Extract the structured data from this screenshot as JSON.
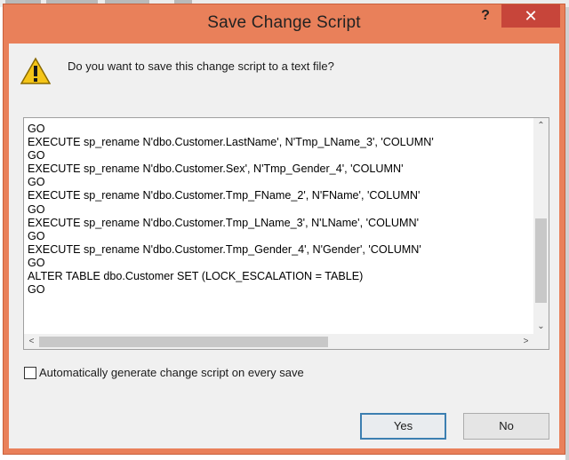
{
  "dialog": {
    "title": "Save Change Script",
    "help_label": "?",
    "close_label": "✕",
    "icon": "warning-icon",
    "prompt": "Do you want to save this change script to a text file?",
    "script_text": "GO\nEXECUTE sp_rename N'dbo.Customer.LastName', N'Tmp_LName_3', 'COLUMN'\nGO\nEXECUTE sp_rename N'dbo.Customer.Sex', N'Tmp_Gender_4', 'COLUMN'\nGO\nEXECUTE sp_rename N'dbo.Customer.Tmp_FName_2', N'FName', 'COLUMN'\nGO\nEXECUTE sp_rename N'dbo.Customer.Tmp_LName_3', N'LName', 'COLUMN'\nGO\nEXECUTE sp_rename N'dbo.Customer.Tmp_Gender_4', N'Gender', 'COLUMN'\nGO\nALTER TABLE dbo.Customer SET (LOCK_ESCALATION = TABLE)\nGO",
    "auto_generate_label": "Automatically generate change script on every save",
    "auto_generate_checked": false,
    "yes_label": "Yes",
    "no_label": "No",
    "scroll_up": "⌃",
    "scroll_down": "⌄",
    "scroll_left": "<",
    "scroll_right": ">"
  },
  "colors": {
    "frame": "#e9805a",
    "close": "#c7453a",
    "client": "#f0f0f0",
    "primary_border": "#3c7fb1"
  }
}
